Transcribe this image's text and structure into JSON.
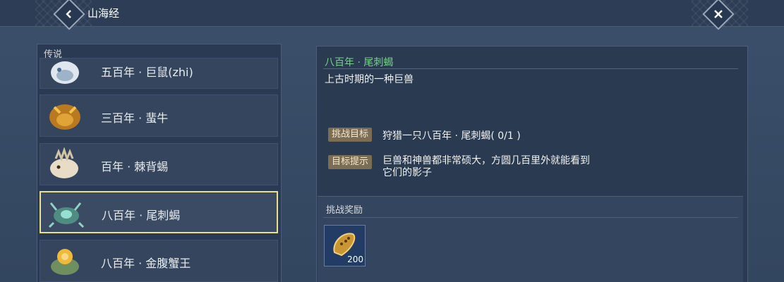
{
  "header": {
    "title": "山海经",
    "back_icon": "chevron-left-icon",
    "close_icon": "close-icon"
  },
  "section": {
    "label": "传说"
  },
  "beasts": [
    {
      "label": "五百年 · 巨鼠(zhi)",
      "icon": "white-beast-icon"
    },
    {
      "label": "三百年 · 蜚牛",
      "icon": "golden-bull-icon"
    },
    {
      "label": "百年 · 棘背蜴",
      "icon": "spiked-lizard-icon"
    },
    {
      "label": "八百年 · 尾刺蝎",
      "icon": "scorpion-icon",
      "selected": true
    },
    {
      "label": "八百年 · 金腹蟹王",
      "icon": "golden-crab-icon"
    }
  ],
  "detail": {
    "name": "八百年 · 尾刺蝎",
    "description": "上古时期的一种巨兽",
    "goal_tag": "挑战目标",
    "goal_text": "狩猎一只八百年 · 尾刺蝎( 0/1 )",
    "hint_tag": "目标提示",
    "hint_text": "巨兽和神兽都非常硕大，方圆几百里外就能看到它们的影子"
  },
  "reward": {
    "label": "挑战奖励",
    "item_icon": "golden-seed-icon",
    "count": "200"
  },
  "colors": {
    "accent_name": "#79d18a",
    "selected_border": "#e9e08a",
    "tag_bg": "#7c6e55"
  }
}
